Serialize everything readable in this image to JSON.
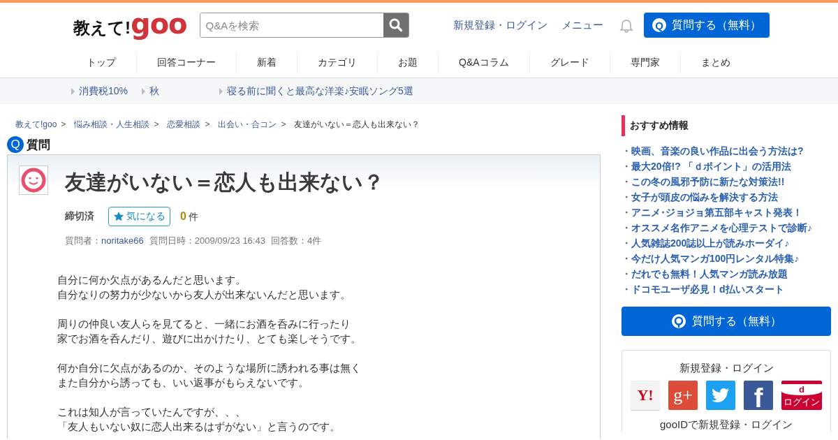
{
  "header": {
    "logo": {
      "prefix": "教えて!",
      "brand": "goo"
    },
    "search": {
      "placeholder": "Q&Aを検索"
    },
    "links": [
      "新規登録・ログイン",
      "メニュー"
    ],
    "ask_button": {
      "icon": "Q",
      "label": "質問する（無料）"
    }
  },
  "nav": [
    {
      "label": "トップ",
      "selected": false
    },
    {
      "label": "回答コーナー",
      "selected": false
    },
    {
      "label": "新着",
      "selected": false
    },
    {
      "label": "カテゴリ",
      "selected": false
    },
    {
      "label": "お題",
      "selected": false
    },
    {
      "label": "Q&Aコラム",
      "selected": false
    },
    {
      "label": "グレード",
      "selected": false
    },
    {
      "label": "専門家",
      "selected": false
    },
    {
      "label": "まとめ",
      "selected": false
    }
  ],
  "trends": [
    "消費税10%",
    "秋",
    "寝る前に聞くと最高な洋楽♪安眠ソング5選"
  ],
  "breadcrumb": {
    "links": [
      "教えて!goo",
      "悩み相談・人生相談",
      "恋愛相談",
      "出会い・合コン"
    ],
    "separator": ">",
    "current": "友達がいない＝恋人も出来ない？"
  },
  "section": {
    "icon": "Q",
    "title": "質問"
  },
  "question": {
    "title": "友達がいない＝恋人も出来ない？",
    "status": "締切済",
    "watch": {
      "label": "気になる",
      "count": "0",
      "unit": "件"
    },
    "meta": {
      "asker_label": "質問者：",
      "asker": "noritake66",
      "date": "質問日時：2009/09/23 16:43",
      "answers": "回答数：4件"
    },
    "body": [
      [
        "自分に何か欠点があるんだと思います。",
        "自分なりの努力が少ないから友人が出来ないんだと思います。"
      ],
      [
        "周りの仲良い友人らを見てると、一緒にお酒を呑みに行ったり",
        "家でお酒を呑んだり、遊びに出かけたり、とても楽しそうです。"
      ],
      [
        "何か自分に欠点があるのか、そのような場所に誘われる事は無く",
        "また自分から誘っても、いい返事がもらえないです。"
      ],
      [
        "これは知人が言っていたんですが、、、",
        "「友人もいない奴に恋人出来るはずがない」と言うのです。"
      ]
    ]
  },
  "sidebar": {
    "title": "おすすめ情報",
    "bullet": "・",
    "items": [
      "映画、音楽の良い作品に出会う方法は?",
      "最大20倍!? 「ｄポイント」の活用法",
      "この冬の風邪予防に新たな対策法!!",
      "女子が頭皮の悩みを解決する方法",
      "アニメ･ジョジョ第五部キャスト発表！",
      "オススメ名作アニメを心理テストで診断♪",
      "人気雑誌200誌以上が読みホーダイ♪",
      "今だけ人気マンガ100円レンタル特集♪",
      "だれでも無料！人気マンガ読み放題",
      "ドコモユーザ必見！d払いスタート"
    ],
    "ask_button": {
      "label": "質問する（無料）"
    },
    "login": {
      "title": "新規登録・ログイン",
      "providers": [
        {
          "kind": "yahoo",
          "text": "Y!"
        },
        {
          "kind": "google",
          "text": "g+"
        },
        {
          "kind": "twitter"
        },
        {
          "kind": "facebook",
          "text": "f"
        },
        {
          "kind": "docomo",
          "text": "d",
          "sub": "ログイン"
        }
      ],
      "gooid": "gooIDで新規登録・ログイン"
    }
  }
}
